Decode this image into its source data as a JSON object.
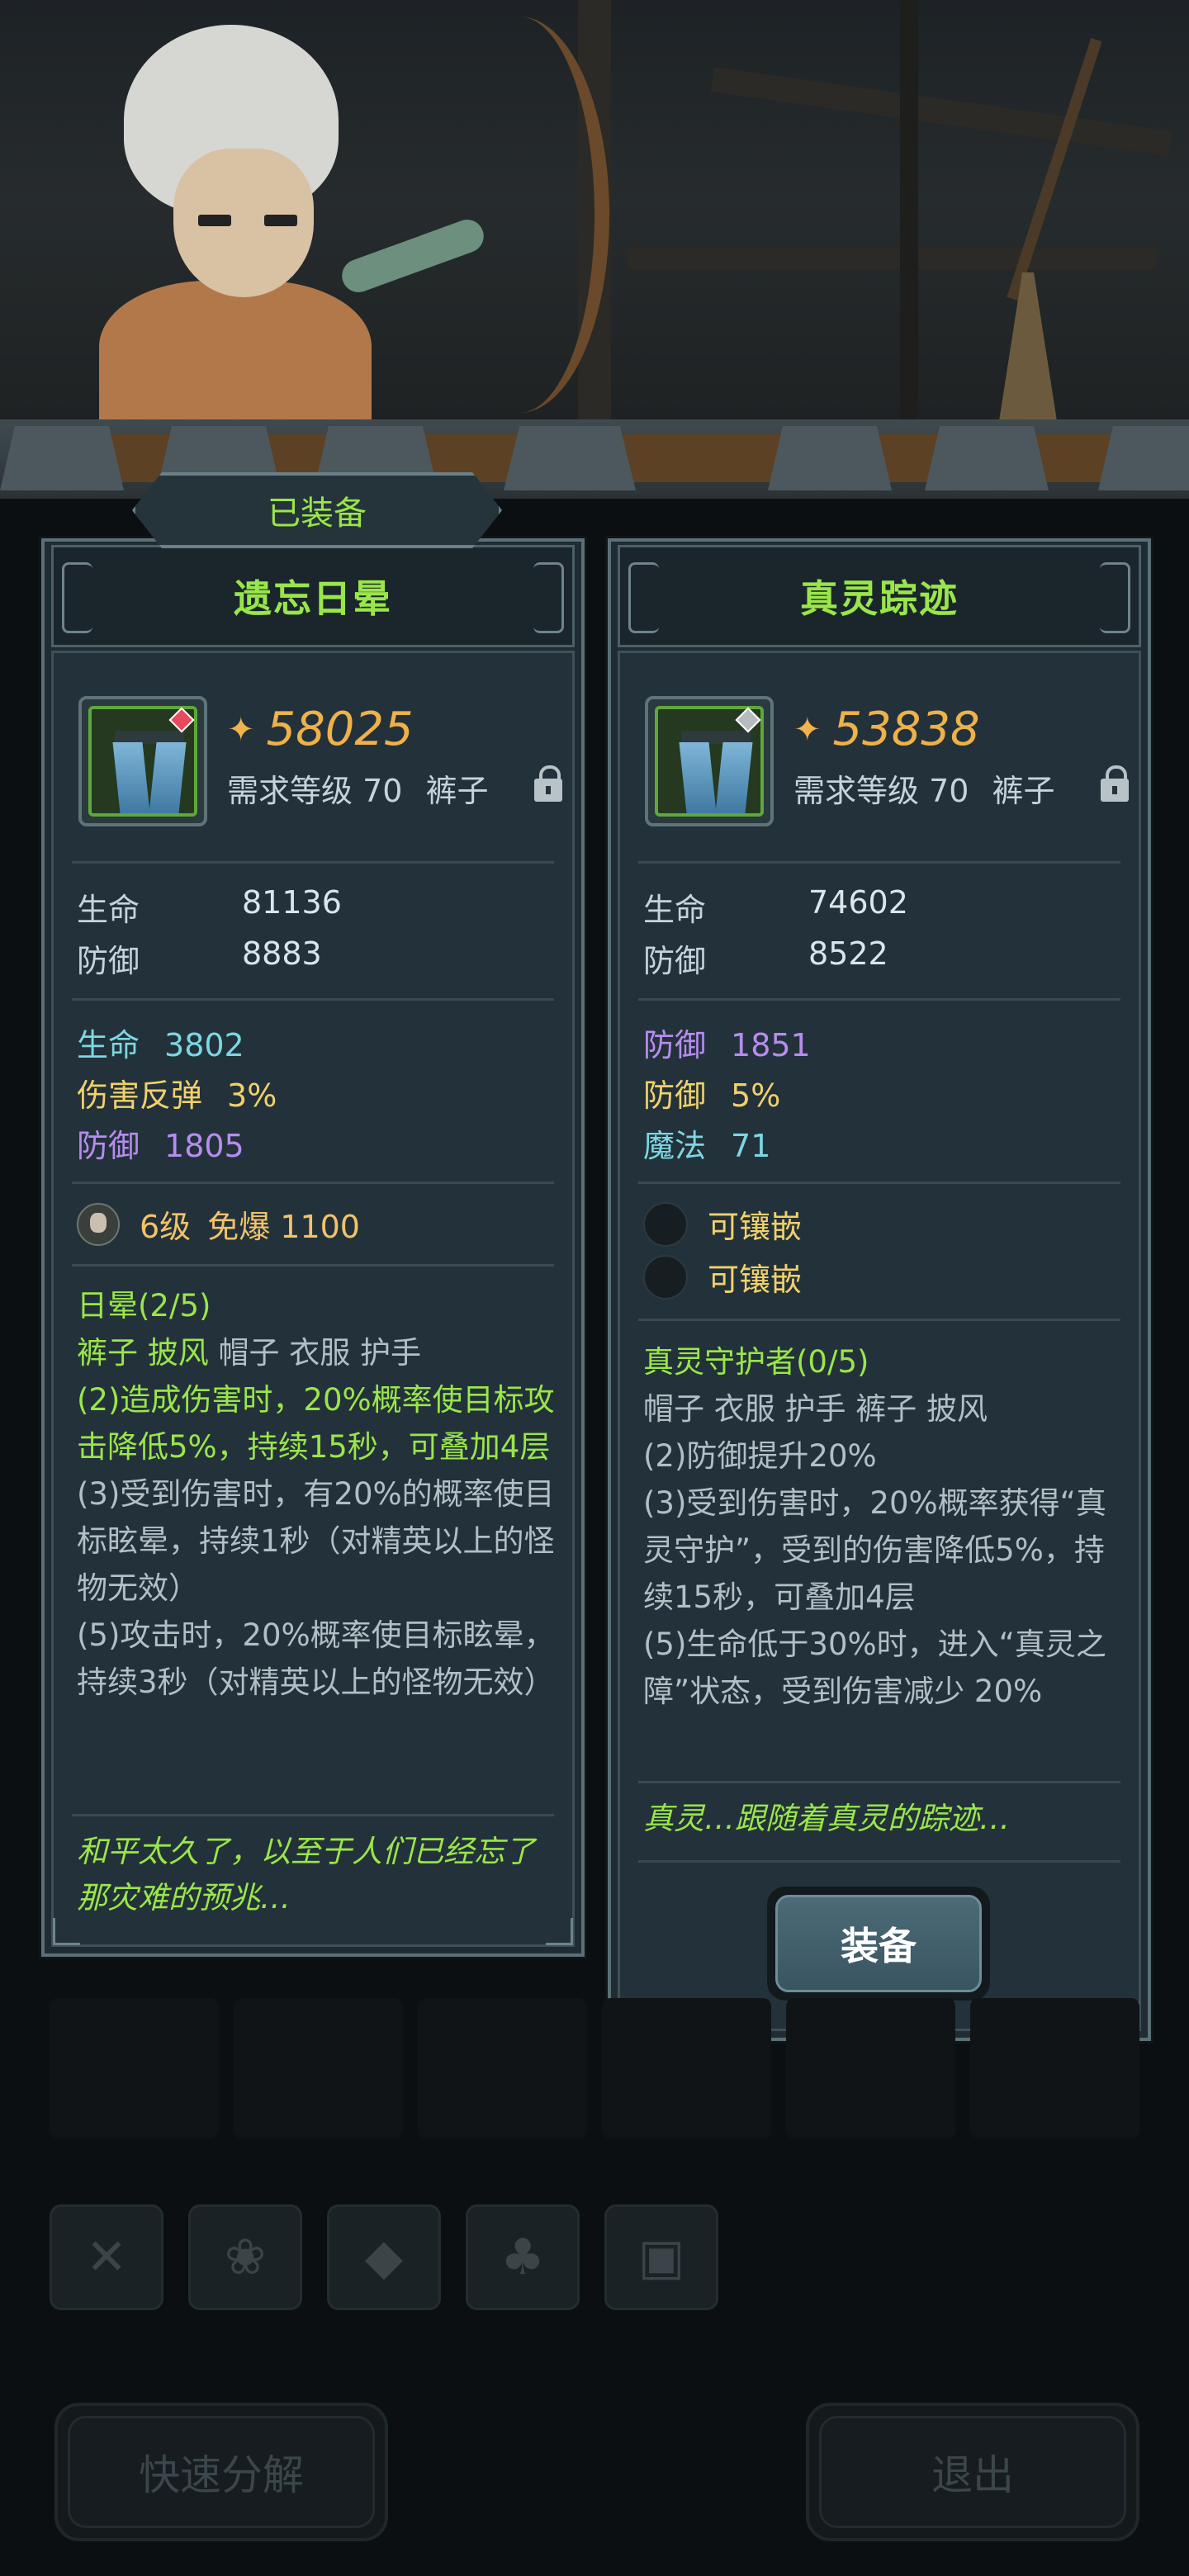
{
  "equipped_tab_label": "已装备",
  "left": {
    "name": "遗忘日晕",
    "score": "58025",
    "level_req": "需求等级 70",
    "slot_type": "裤子",
    "base": [
      {
        "k": "生命",
        "v": "81136"
      },
      {
        "k": "防御",
        "v": "8883"
      }
    ],
    "extra": [
      {
        "k": "生命",
        "v": "3802"
      },
      {
        "k": "伤害反弹",
        "v": "3%"
      },
      {
        "k": "防御",
        "v": "1805"
      }
    ],
    "gem": {
      "level": "6级",
      "text": "免爆 1100"
    },
    "set_title": "日晕(2/5)",
    "set_pieces_active": "裤子 披风",
    "set_pieces_inactive": "帽子 衣服 护手",
    "set_effects": [
      "(2)造成伤害时，20%概率使目标攻击降低5%，持续15秒，可叠加4层",
      "(3)受到伤害时，有20%的概率使目标眩晕，持续1秒（对精英以上的怪物无效）",
      "(5)攻击时，20%概率使目标眩晕，持续3秒（对精英以上的怪物无效）"
    ],
    "flavor": "和平太久了，以至于人们已经忘了那灾难的预兆…"
  },
  "right": {
    "name": "真灵踪迹",
    "score": "53838",
    "level_req": "需求等级 70",
    "slot_type": "裤子",
    "base": [
      {
        "k": "生命",
        "v": "74602"
      },
      {
        "k": "防御",
        "v": "8522"
      }
    ],
    "extra": [
      {
        "k": "防御",
        "v": "1851"
      },
      {
        "k": "防御",
        "v": "5%"
      },
      {
        "k": "魔法",
        "v": "71"
      }
    ],
    "sockets": [
      "可镶嵌",
      "可镶嵌"
    ],
    "set_title": "真灵守护者(0/5)",
    "set_pieces": "帽子 衣服 护手 裤子 披风",
    "set_effects": [
      "(2)防御提升20%",
      "(3)受到伤害时，20%概率获得“真灵守护”，受到的伤害降低5%，持续15秒，可叠加4层",
      "(5)生命低于30%时，进入“真灵之障”状态，受到伤害减少 20%"
    ],
    "flavor": "真灵…跟随着真灵的踪迹…",
    "equip_button": "装备"
  },
  "bottom": {
    "quick_decompose": "快速分解",
    "exit": "退出"
  },
  "colors": {
    "title_green": "#9ae64a",
    "score_gold": "#efb14a",
    "cyan_attr": "#7dd6e3",
    "yellow_attr": "#f1d16c",
    "purple_attr": "#b78cf0"
  }
}
